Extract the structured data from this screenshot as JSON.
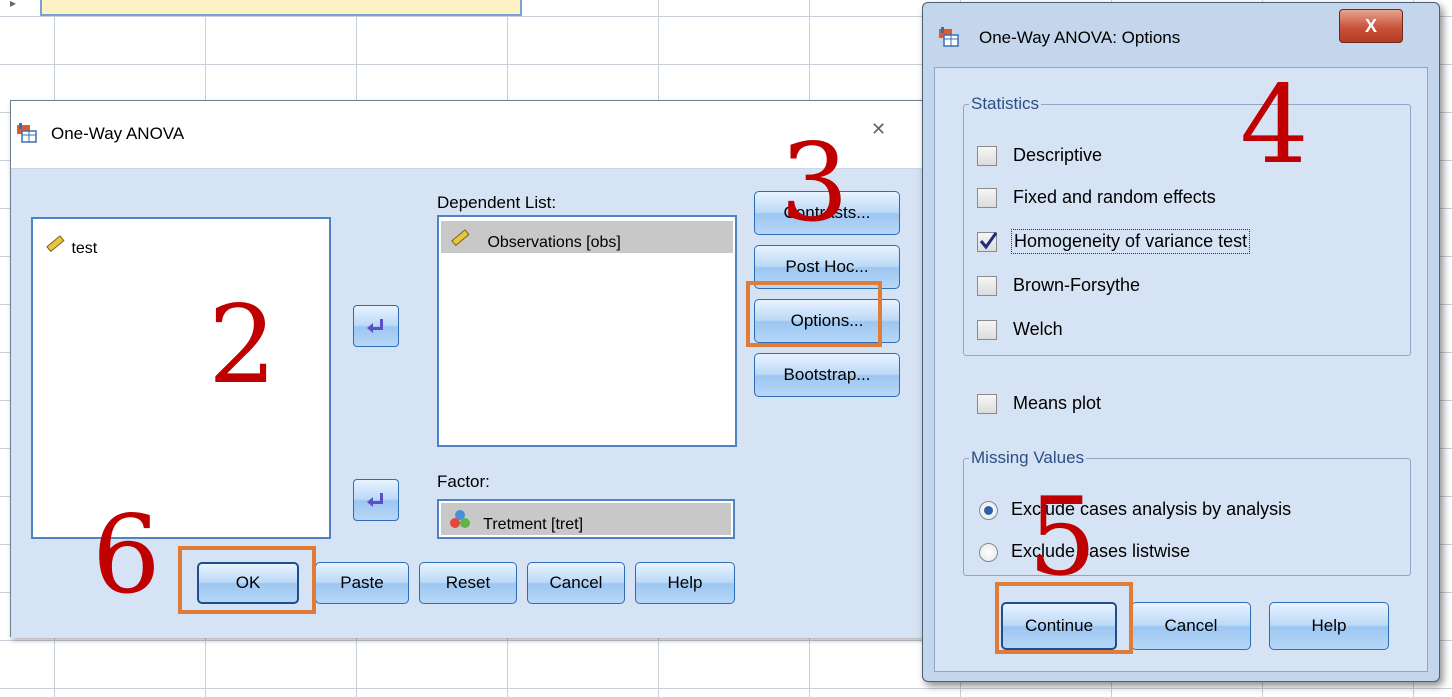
{
  "main_dialog": {
    "title": "One-Way ANOVA",
    "close_symbol": "✕",
    "variables": [
      "test"
    ],
    "dependent_label": "Dependent List:",
    "dependent_items": [
      "Observations [obs]"
    ],
    "factor_label": "Factor:",
    "factor_value": "Tretment [tret]",
    "side_buttons": [
      "Contrasts...",
      "Post Hoc...",
      "Options...",
      "Bootstrap..."
    ],
    "bottom_buttons": [
      "OK",
      "Paste",
      "Reset",
      "Cancel",
      "Help"
    ]
  },
  "options_dialog": {
    "title": "One-Way ANOVA: Options",
    "close_symbol": "X",
    "statistics_label": "Statistics",
    "statistics": [
      {
        "label": "Descriptive",
        "checked": false
      },
      {
        "label": "Fixed and random effects",
        "checked": false
      },
      {
        "label": "Homogeneity of variance test",
        "checked": true
      },
      {
        "label": "Brown-Forsythe",
        "checked": false
      },
      {
        "label": "Welch",
        "checked": false
      }
    ],
    "means_plot": {
      "label": "Means plot",
      "checked": false
    },
    "missing_label": "Missing Values",
    "missing_options": [
      {
        "label": "Exclude cases analysis by analysis",
        "selected": true
      },
      {
        "label": "Exclude cases listwise",
        "selected": false
      }
    ],
    "buttons": [
      "Continue",
      "Cancel",
      "Help"
    ]
  },
  "step_labels": [
    "2",
    "3",
    "4",
    "5",
    "6"
  ],
  "colors": {
    "highlight": "#de7d3a",
    "step_number": "#c00000",
    "dialog_body": "#d6e3f4"
  }
}
